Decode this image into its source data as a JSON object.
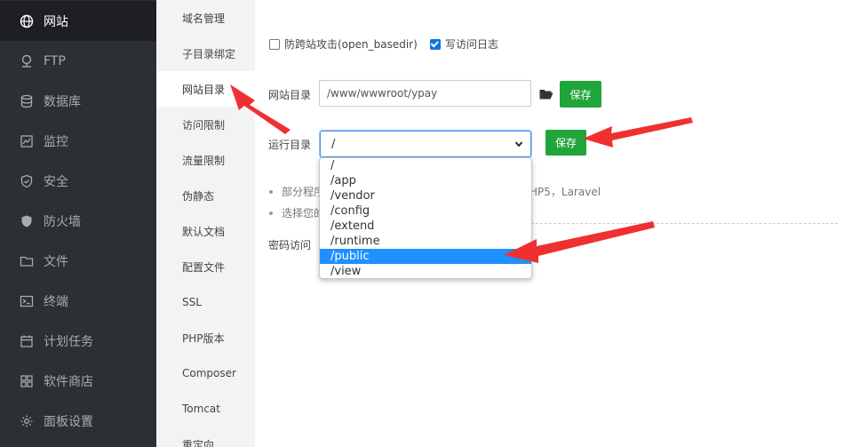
{
  "sidebar": {
    "items": [
      {
        "label": "网站",
        "icon": "globe-icon",
        "active": true
      },
      {
        "label": "FTP",
        "icon": "ftp-icon"
      },
      {
        "label": "数据库",
        "icon": "database-icon"
      },
      {
        "label": "监控",
        "icon": "monitor-icon"
      },
      {
        "label": "安全",
        "icon": "shield-icon"
      },
      {
        "label": "防火墙",
        "icon": "firewall-icon"
      },
      {
        "label": "文件",
        "icon": "folder-icon"
      },
      {
        "label": "终端",
        "icon": "terminal-icon"
      },
      {
        "label": "计划任务",
        "icon": "calendar-icon"
      },
      {
        "label": "软件商店",
        "icon": "apps-icon"
      },
      {
        "label": "面板设置",
        "icon": "gear-icon"
      }
    ]
  },
  "submenu": {
    "items": [
      "域名管理",
      "子目录绑定",
      "网站目录",
      "访问限制",
      "流量限制",
      "伪静态",
      "默认文档",
      "配置文件",
      "SSL",
      "PHP版本",
      "Composer",
      "Tomcat",
      "重定向"
    ],
    "active_index": 2
  },
  "main": {
    "chk_basedir": "防跨站攻击(open_basedir)",
    "chk_log": "写访问日志",
    "site_dir_label": "网站目录",
    "site_dir_value": "/www/wwwroot/ypay",
    "save_label_1": "保存",
    "run_dir_label": "运行目录",
    "run_dir_value": "/",
    "save_label_2": "保存",
    "note1_a": "部分程序",
    "note1_b": "HP5，Laravel",
    "note2_a": "选择您的",
    "password_label": "密码访问",
    "dropdown_options": [
      "/",
      "/app",
      "/vendor",
      "/config",
      "/extend",
      "/runtime",
      "/public",
      "/view"
    ],
    "dropdown_selected_index": 6
  },
  "colors": {
    "sidebar_bg": "#2c2f33",
    "save_green": "#20a53a",
    "select_highlight": "#1e90ff",
    "arrow_red": "#f03030"
  }
}
